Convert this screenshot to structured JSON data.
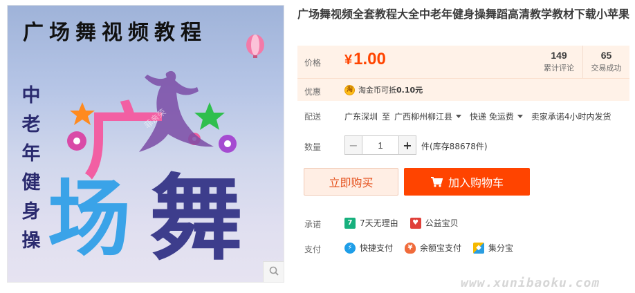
{
  "image": {
    "headline": "广场舞视频教程",
    "vertical_text": [
      "中",
      "老",
      "年",
      "健",
      "身",
      "操"
    ],
    "big_chars": [
      "广",
      "场",
      "舞"
    ],
    "watermark": "菲亲荣",
    "zoom_icon": "search-icon"
  },
  "product": {
    "title": "广场舞视频全套教程大全中老年健身操舞蹈高清教学教材下载小苹果"
  },
  "price": {
    "label": "价格",
    "symbol": "¥",
    "value": "1.00",
    "color": "#ff4400",
    "stats": [
      {
        "num": "149",
        "caption": "累计评论"
      },
      {
        "num": "65",
        "caption": "交易成功"
      }
    ]
  },
  "promo": {
    "label": "优惠",
    "icon": "coin-icon",
    "icon_char": "淘",
    "text_prefix": "淘金币可抵",
    "amount": "0.10元"
  },
  "shipping": {
    "label": "配送",
    "from": "广东深圳",
    "to_word": "至",
    "to": "广西柳州柳江县",
    "method": "快递 免运费",
    "promise": "卖家承诺4小时内发货"
  },
  "quantity": {
    "label": "数量",
    "value": "1",
    "minus": "−",
    "plus": "+",
    "stock": "件(库存88678件)"
  },
  "actions": {
    "buy_now": "立即购买",
    "add_cart": "加入购物车"
  },
  "promise": {
    "label": "承诺",
    "items": [
      {
        "icon": "seven-day-return-icon",
        "icon_char": "7",
        "color": "#17b07d",
        "text": "7天无理由"
      },
      {
        "icon": "charity-icon",
        "icon_char": "♥",
        "color": "#e0403a",
        "text": "公益宝贝"
      }
    ]
  },
  "payment": {
    "label": "支付",
    "items": [
      {
        "icon": "quick-pay-icon",
        "icon_char": "⚡",
        "color": "#1e9ee8",
        "text": "快捷支付"
      },
      {
        "icon": "yuebao-icon",
        "icon_char": "¥",
        "color": "#f06b3b",
        "text": "余额宝支付"
      },
      {
        "icon": "jifenbao-icon",
        "icon_char": "◆",
        "color": "#2a9de0",
        "text": "集分宝"
      }
    ]
  },
  "site_watermark": "www.xunibaoku.com"
}
